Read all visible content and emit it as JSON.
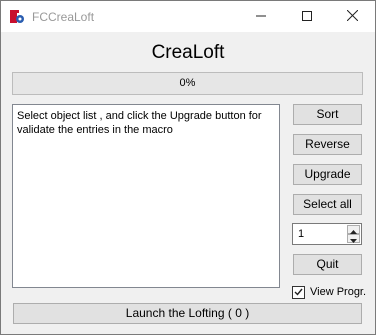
{
  "window": {
    "title": "FCCreaLoft"
  },
  "heading": "CreaLoft",
  "progress": {
    "label": "0%",
    "value": 0
  },
  "message": "Select object list , and click the Upgrade button for validate the entries in the macro",
  "buttons": {
    "sort": "Sort",
    "reverse": "Reverse",
    "upgrade": "Upgrade",
    "select_all": "Select all",
    "quit": "Quit",
    "launch": "Launch the Lofting ( 0 )"
  },
  "spinner": {
    "value": "1"
  },
  "view_progress": {
    "label": "View Progr.",
    "checked": true
  },
  "icons": {
    "app": "freecad-gear-icon",
    "minimize": "minimize-icon",
    "maximize": "maximize-icon",
    "close": "close-icon"
  }
}
